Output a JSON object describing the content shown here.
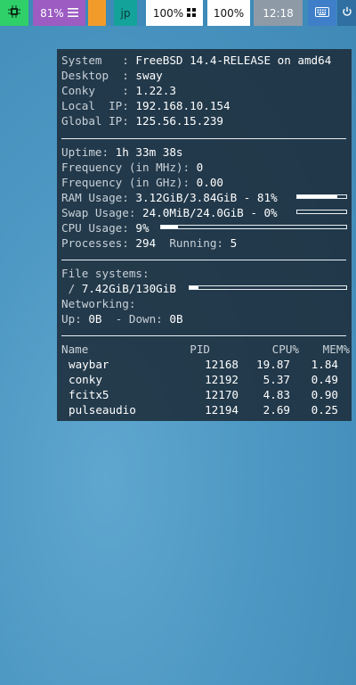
{
  "topbar": {
    "cpu_icon": "chip-icon",
    "battery": "81%",
    "battery_icon": "menu-lines-icon",
    "ime": "jp",
    "brightness": "100%",
    "brightness_icon": "grid-icon",
    "volume": "100%",
    "clock": "12:18",
    "keyboard_icon": "keyboard-icon",
    "power_icon": "power-icon"
  },
  "sysinfo": {
    "system_label": "System   :",
    "system": "FreeBSD 14.4-RELEASE on amd64",
    "desktop_label": "Desktop  :",
    "desktop": "sway",
    "conky_label": "Conky    :",
    "conky": "1.22.3",
    "local_ip_label": "Local  IP:",
    "local_ip": "192.168.10.154",
    "global_ip_label": "Global IP:",
    "global_ip": "125.56.15.239"
  },
  "stats": {
    "uptime_label": "Uptime:",
    "uptime": "1h 33m 38s",
    "freq_mhz_label": "Frequency (in MHz):",
    "freq_mhz": "0",
    "freq_ghz_label": "Frequency (in GHz):",
    "freq_ghz": "0.00",
    "ram_label": "RAM Usage:",
    "ram": "3.12GiB/3.84GiB - 81%",
    "ram_fraction": 0.81,
    "swap_label": "Swap Usage:",
    "swap": "24.0MiB/24.0GiB - 0%",
    "swap_fraction": 0.0,
    "cpu_label": "CPU Usage:",
    "cpu": "9%",
    "cpu_fraction": 0.09,
    "processes_label": "Processes:",
    "processes": "294",
    "running_label": "Running:",
    "running": "5"
  },
  "filesystems": {
    "title": "File systems:",
    "root_label": " /",
    "root": "7.42GiB/130GiB",
    "root_fraction": 0.057,
    "networking_label": "Networking:",
    "up_label": "Up:",
    "up": "0B",
    "down_label": " - Down:",
    "down": "0B"
  },
  "processes_table": {
    "headers": {
      "name": "Name",
      "pid": "PID",
      "cpu": "CPU%",
      "mem": "MEM%"
    },
    "rows": [
      {
        "name": "waybar",
        "pid": "12168",
        "cpu": "19.87",
        "mem": "1.84"
      },
      {
        "name": "conky",
        "pid": "12192",
        "cpu": "5.37",
        "mem": "0.49"
      },
      {
        "name": "fcitx5",
        "pid": "12170",
        "cpu": "4.83",
        "mem": "0.90"
      },
      {
        "name": "pulseaudio",
        "pid": "12194",
        "cpu": "2.69",
        "mem": "0.25"
      }
    ]
  }
}
